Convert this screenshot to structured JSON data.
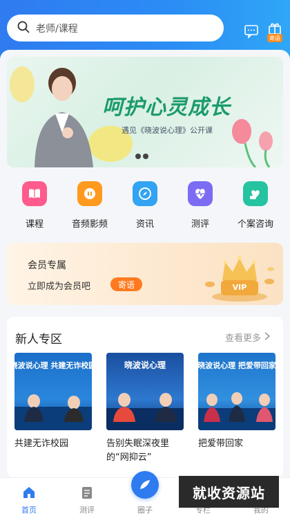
{
  "search": {
    "placeholder": "老师/课程"
  },
  "header": {
    "gift_badge": "寄语"
  },
  "banner": {
    "title": "呵护心灵成长",
    "subtitle": "遇见《晓波说心理》公开课"
  },
  "categories": [
    {
      "label": "课程",
      "icon": "book-icon",
      "color": "#ff5b8c"
    },
    {
      "label": "音频影频",
      "icon": "audio-icon",
      "color": "#ff9a1f"
    },
    {
      "label": "资讯",
      "icon": "compass-icon",
      "color": "#33a3f4"
    },
    {
      "label": "测评",
      "icon": "heart-pulse-icon",
      "color": "#7b6cf3"
    },
    {
      "label": "个案咨询",
      "icon": "consult-icon",
      "color": "#26c3a0"
    }
  ],
  "vip": {
    "title": "会员专属",
    "subtitle": "立即成为会员吧",
    "button": "寄语",
    "badge_text": "VIP"
  },
  "newbie": {
    "title": "新人专区",
    "more": "查看更多",
    "cards": [
      {
        "title": "共建无诈校园",
        "thumb_text": "晓波说心理 共建无诈校园"
      },
      {
        "title": "告别失眠深夜里的“网抑云”",
        "thumb_text": "晓波说心理"
      },
      {
        "title": "把爱带回家",
        "thumb_text": "晓波说心理 把爱带回家"
      }
    ]
  },
  "tabbar": [
    {
      "label": "首页",
      "icon": "home-icon",
      "active": true
    },
    {
      "label": "测评",
      "icon": "clipboard-icon",
      "active": false
    },
    {
      "label": "圈子",
      "icon": "circle-icon",
      "active": false
    },
    {
      "label": "专栏",
      "icon": "column-icon",
      "active": false
    },
    {
      "label": "我的",
      "icon": "user-icon",
      "active": false
    }
  ],
  "watermark": "就收资源站",
  "colors": {
    "primary": "#2f7bf0",
    "accent_orange": "#ff7a1f"
  }
}
